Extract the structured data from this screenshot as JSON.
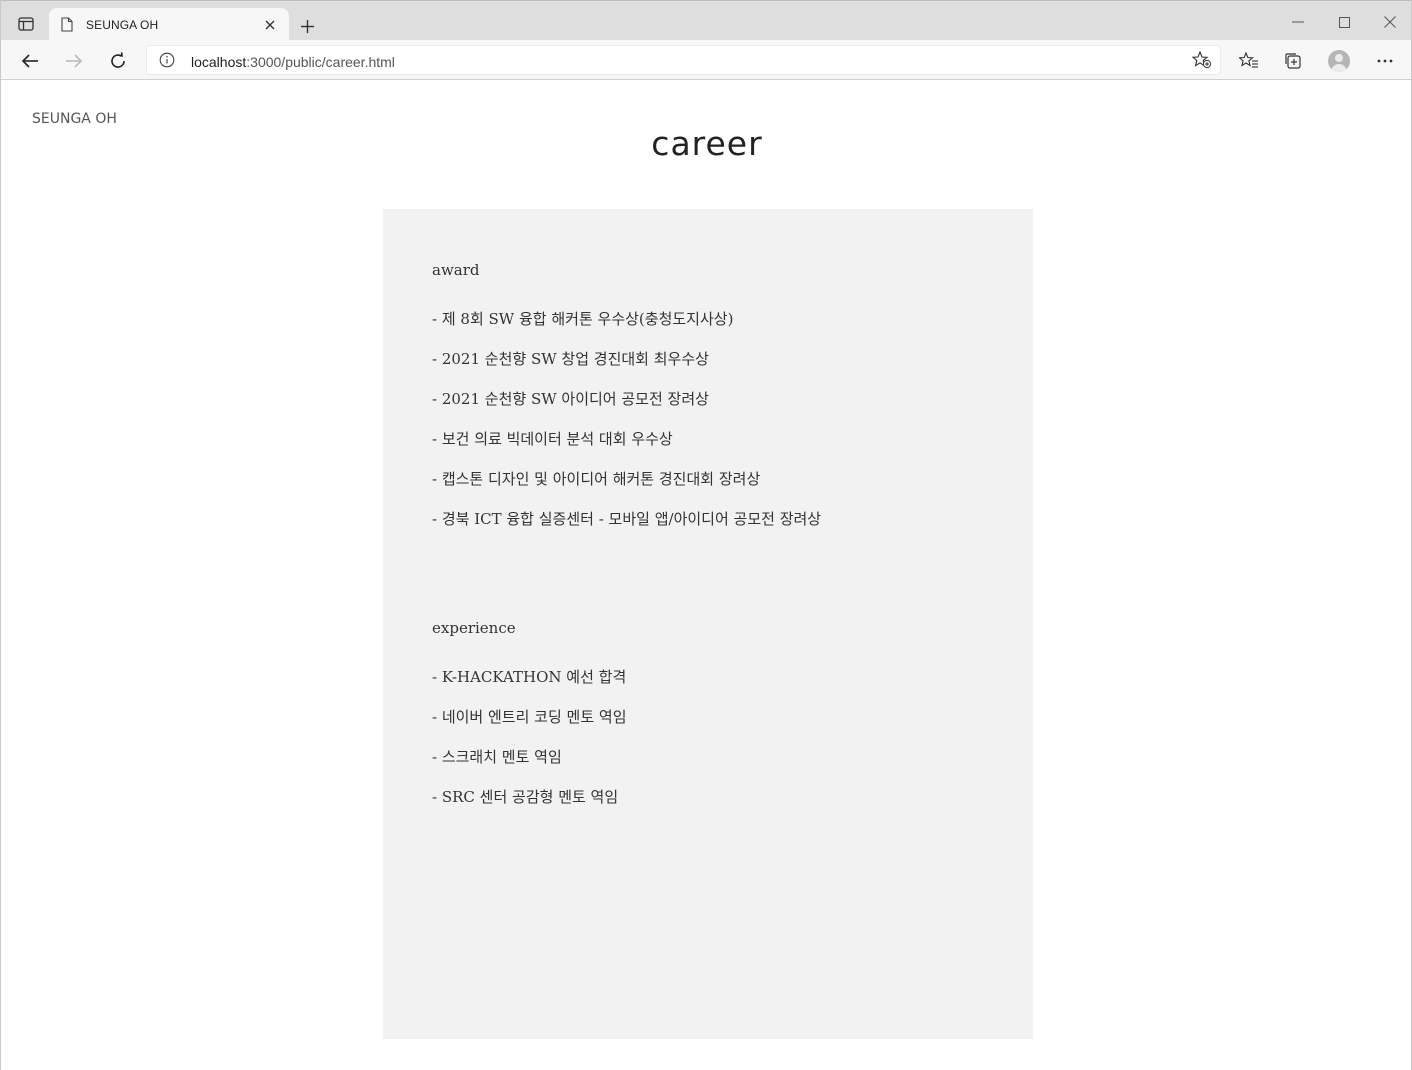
{
  "browser": {
    "tab": {
      "title": "SEUNGA OH"
    },
    "address_bar": {
      "host": "localhost",
      "rest": ":3000/public/career.html"
    }
  },
  "page": {
    "logo": "SEUNGA OH",
    "title": "career",
    "sections": [
      {
        "heading": "award",
        "items": [
          "- 제 8회 SW 융합 해커톤 우수상(충청도지사상)",
          "- 2021 순천향 SW 창업 경진대회 최우수상",
          "- 2021 순천향 SW 아이디어 공모전 장려상",
          "- 보건 의료 빅데이터 분석 대회 우수상",
          "- 캡스톤 디자인 및 아이디어 해커톤 경진대회 장려상",
          "- 경북 ICT 융합 실증센터 - 모바일 앱/아이디어 공모전 장려상"
        ]
      },
      {
        "heading": "experience",
        "items": [
          "- K-HACKATHON 예선 합격",
          "- 네이버 엔트리 코딩 멘토 역임",
          "- 스크래치 멘토 역임",
          "- SRC 센터 공감형 멘토 역임"
        ]
      }
    ]
  },
  "icons": {
    "tab_actions": "tab-actions-icon",
    "document": "document-icon",
    "close": "close-icon",
    "new_tab": "plus-icon",
    "back": "back-arrow-icon",
    "forward": "forward-arrow-icon",
    "refresh": "refresh-icon",
    "site_info": "info-icon",
    "add_favorite": "star-add-icon",
    "favorites": "favorites-icon",
    "collections": "collections-icon",
    "profile": "profile-avatar-icon",
    "menu": "more-icon",
    "minimize": "minimize-icon",
    "maximize": "maximize-icon",
    "window_close": "window-close-icon"
  }
}
